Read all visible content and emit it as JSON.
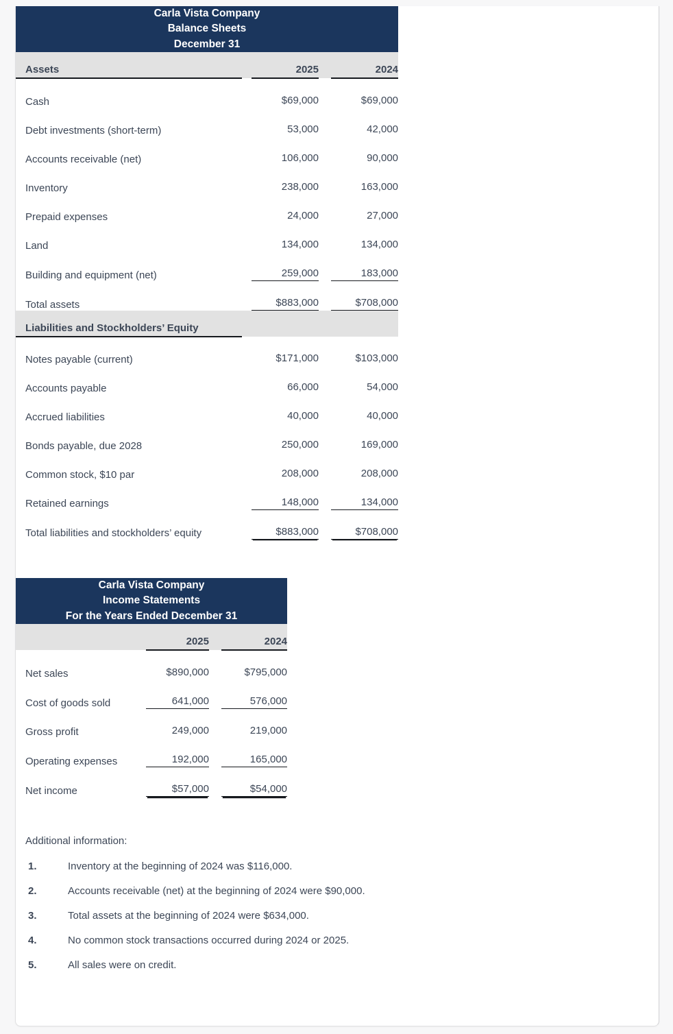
{
  "balance_sheet": {
    "title_lines": [
      "Carla Vista Company",
      "Balance Sheets",
      "December 31"
    ],
    "assets_header_label": "Assets",
    "year_2025": "2025",
    "year_2024": "2024",
    "asset_rows": [
      {
        "label": "Cash",
        "y2025": "$69,000",
        "y2024": "$69,000",
        "rule": "none"
      },
      {
        "label": "Debt investments (short-term)",
        "y2025": "53,000",
        "y2024": "42,000",
        "rule": "none"
      },
      {
        "label": "Accounts receivable (net)",
        "y2025": "106,000",
        "y2024": "90,000",
        "rule": "none"
      },
      {
        "label": "Inventory",
        "y2025": "238,000",
        "y2024": "163,000",
        "rule": "none"
      },
      {
        "label": "Prepaid expenses",
        "y2025": "24,000",
        "y2024": "27,000",
        "rule": "none"
      },
      {
        "label": "Land",
        "y2025": "134,000",
        "y2024": "134,000",
        "rule": "none"
      },
      {
        "label": "Building and equipment (net)",
        "y2025": "259,000",
        "y2024": "183,000",
        "rule": "single"
      },
      {
        "label": "Total assets",
        "y2025": "$883,000",
        "y2024": "$708,000",
        "rule": "double"
      }
    ],
    "liabilities_header_label": "Liabilities and Stockholders’ Equity",
    "liability_rows": [
      {
        "label": "Notes payable (current)",
        "y2025": "$171,000",
        "y2024": "$103,000",
        "rule": "none"
      },
      {
        "label": "Accounts payable",
        "y2025": "66,000",
        "y2024": "54,000",
        "rule": "none"
      },
      {
        "label": "Accrued liabilities",
        "y2025": "40,000",
        "y2024": "40,000",
        "rule": "none"
      },
      {
        "label": "Bonds payable, due 2028",
        "y2025": "250,000",
        "y2024": "169,000",
        "rule": "none"
      },
      {
        "label": "Common stock, $10 par",
        "y2025": "208,000",
        "y2024": "208,000",
        "rule": "none"
      },
      {
        "label": "Retained earnings",
        "y2025": "148,000",
        "y2024": "134,000",
        "rule": "single"
      },
      {
        "label": "Total liabilities and stockholders’ equity",
        "y2025": "$883,000",
        "y2024": "$708,000",
        "rule": "double"
      }
    ]
  },
  "income_statement": {
    "title_lines": [
      "Carla Vista Company",
      "Income Statements",
      "For the Years Ended December 31"
    ],
    "row_header_label": "",
    "year_2025": "2025",
    "year_2024": "2024",
    "rows": [
      {
        "label": "Net sales",
        "y2025": "$890,000",
        "y2024": "$795,000",
        "rule": "none"
      },
      {
        "label": "Cost of goods sold",
        "y2025": "641,000",
        "y2024": "576,000",
        "rule": "single"
      },
      {
        "label": "Gross profit",
        "y2025": "249,000",
        "y2024": "219,000",
        "rule": "none"
      },
      {
        "label": "Operating expenses",
        "y2025": "192,000",
        "y2024": "165,000",
        "rule": "single"
      },
      {
        "label": "Net income",
        "y2025": "$57,000",
        "y2024": "$54,000",
        "rule": "double"
      }
    ]
  },
  "additional_information": {
    "heading": "Additional information:",
    "items": [
      {
        "number": "1.",
        "text": "Inventory at the beginning of 2024 was $116,000."
      },
      {
        "number": "2.",
        "text": "Accounts receivable (net) at the beginning of 2024 were $90,000."
      },
      {
        "number": "3.",
        "text": "Total assets at the beginning of 2024 were $634,000."
      },
      {
        "number": "4.",
        "text": "No common stock transactions occurred during 2024 or 2025."
      },
      {
        "number": "5.",
        "text": "All sales were on credit."
      }
    ]
  },
  "colors": {
    "header_navy": "#1b365d",
    "band_gray": "#e2e2e2",
    "text": "#3c4656",
    "rule": "#15181d",
    "page_bg": "#f7f7f8",
    "panel_bg": "#ffffff"
  }
}
